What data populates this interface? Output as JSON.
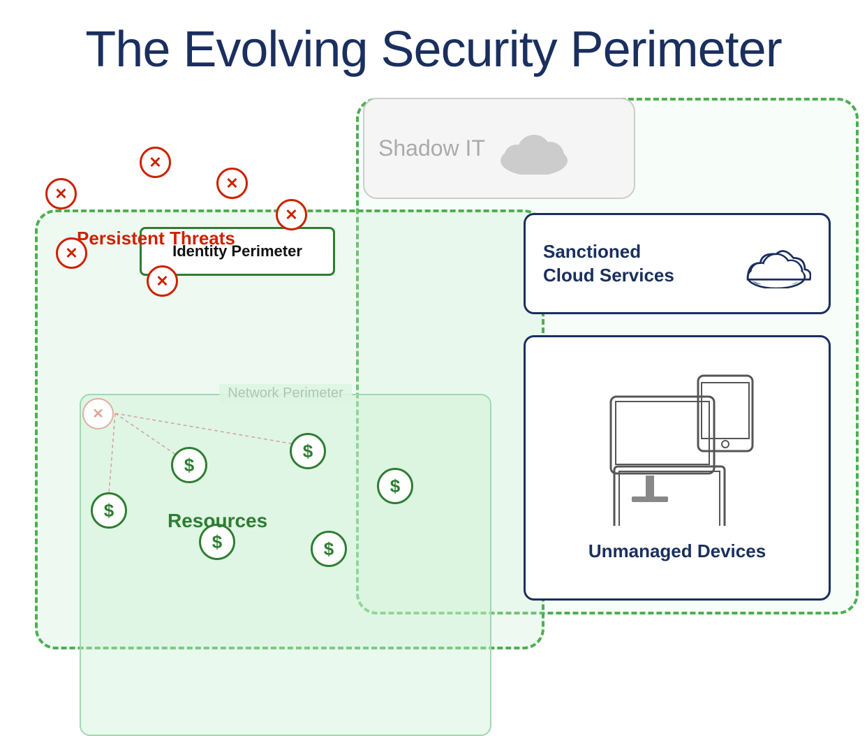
{
  "title": "The Evolving Security Perimeter",
  "labels": {
    "shadow_it": "Shadow IT",
    "sanctioned_cloud": "Sanctioned Cloud Services",
    "unmanaged_devices": "Unmanaged Devices",
    "identity_perimeter": "Identity Perimeter",
    "network_perimeter": "Network Perimeter",
    "persistent_threats": "Persistent Threats",
    "resources": "Resources"
  },
  "colors": {
    "title_blue": "#1a2f5e",
    "green_dark": "#2e7d32",
    "green_dashed": "#4caf50",
    "red_threat": "#cc2200",
    "shadow_it_gray": "#aaaaaa",
    "light_green_bg": "rgba(200,240,210,0.3)"
  }
}
